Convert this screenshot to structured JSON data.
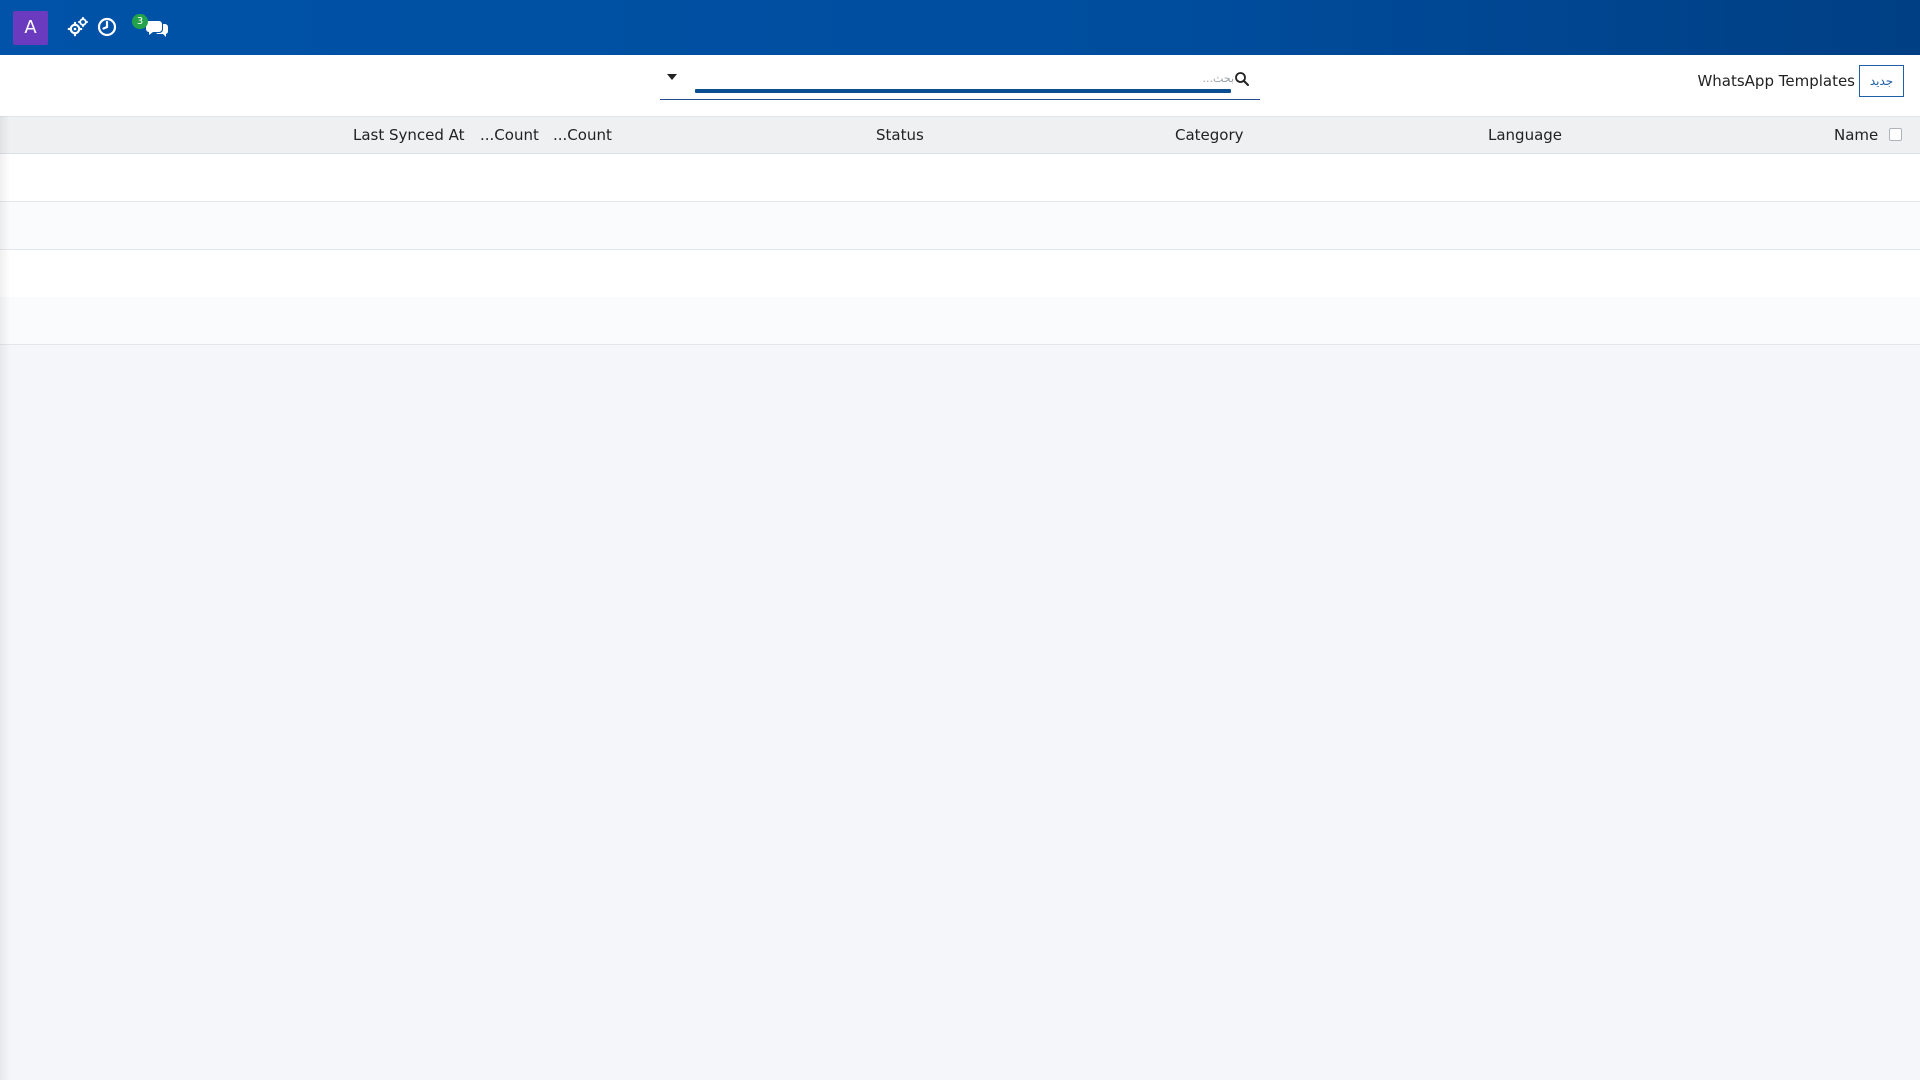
{
  "navbar": {
    "avatar_letter": "A",
    "icons": [
      "settings-gears-icon",
      "activity-clock-icon",
      "discuss-chat-icon"
    ],
    "chat_badge_count": "3",
    "colors": {
      "bar_start": "#0053a8",
      "bar_end": "#003f84",
      "avatar": "#6b3bbf",
      "badge": "#22a24a"
    }
  },
  "control_panel": {
    "new_button_label": "جديد",
    "title": "WhatsApp Templates",
    "search": {
      "placeholder": "بحث...",
      "value": ""
    }
  },
  "table": {
    "columns": [
      "Name",
      "Language",
      "Category",
      "Status",
      "...Count",
      "...Count",
      "Last Synced At"
    ],
    "rows": [
      {
        "empty": true
      },
      {
        "empty": true
      },
      {
        "empty": true
      },
      {
        "empty": true
      }
    ]
  }
}
